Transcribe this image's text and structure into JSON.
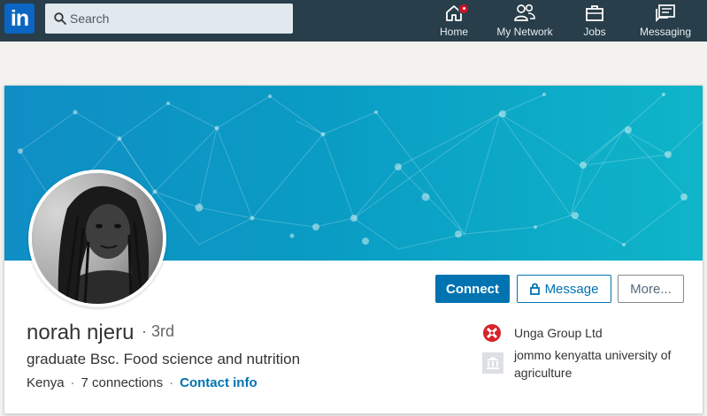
{
  "nav": {
    "logo_text": "in",
    "search_placeholder": "Search",
    "items": [
      {
        "label": "Home",
        "icon": "home-icon"
      },
      {
        "label": "My Network",
        "icon": "network-icon"
      },
      {
        "label": "Jobs",
        "icon": "briefcase-icon"
      },
      {
        "label": "Messaging",
        "icon": "messaging-icon"
      }
    ]
  },
  "profile": {
    "name": "norah njeru",
    "degree": "3rd",
    "headline": "graduate Bsc. Food science and nutrition",
    "location": "Kenya",
    "connections": "7 connections",
    "contact_info": "Contact info",
    "actions": {
      "connect": "Connect",
      "message": "Message",
      "more": "More..."
    },
    "current_company": {
      "name": "Unga Group Ltd",
      "logo": "unga-logo"
    },
    "education": {
      "name": "jommo kenyatta university of agriculture",
      "logo": "school-placeholder-icon"
    }
  },
  "colors": {
    "nav_bg": "#283e4a",
    "brand": "#0073b1",
    "banner": "#0a9cc4",
    "badge": "#d11124"
  }
}
